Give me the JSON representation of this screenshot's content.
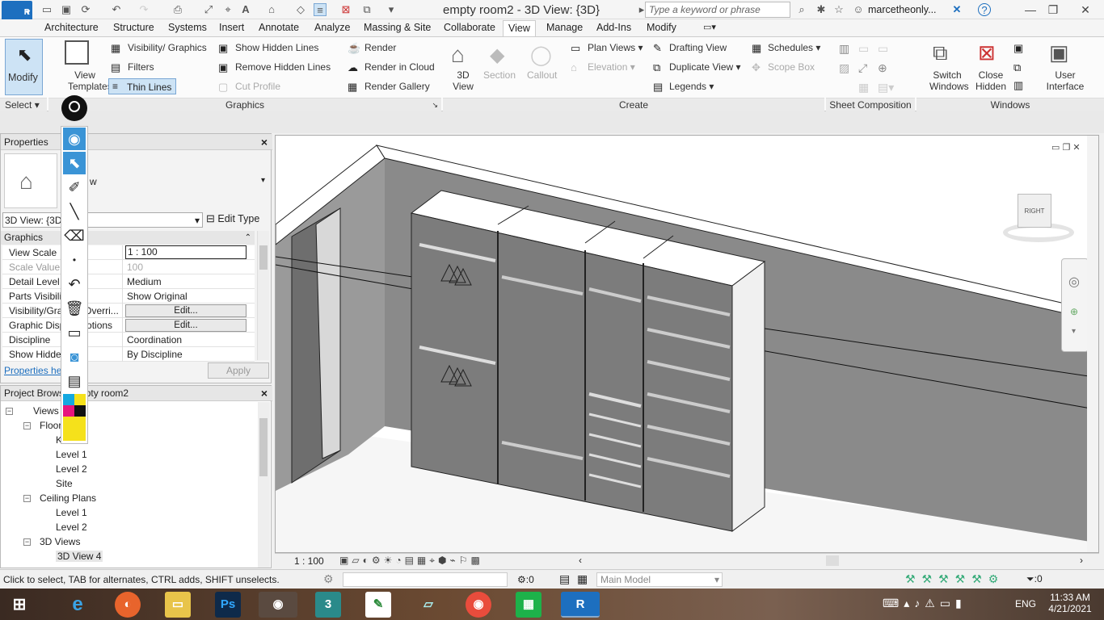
{
  "app": {
    "logo": "R",
    "title": "empty room2 - 3D View: {3D}",
    "search_placeholder": "Type a keyword or phrase",
    "user": "marcetheonly...",
    "accent": "#1d6fbf"
  },
  "tabs": [
    "Architecture",
    "Structure",
    "Systems",
    "Insert",
    "Annotate",
    "Analyze",
    "Massing & Site",
    "Collaborate",
    "View",
    "Manage",
    "Add-Ins",
    "Modify"
  ],
  "active_tab": "View",
  "ribbon": {
    "modify_label": "Modify",
    "select_label": "Select",
    "view_templates": "View Templates",
    "visibility_graphics": "Visibility/ Graphics",
    "filters": "Filters",
    "thin_lines": "Thin Lines",
    "show_hidden": "Show Hidden Lines",
    "remove_hidden": "Remove Hidden Lines",
    "cut_profile": "Cut Profile",
    "render": "Render",
    "render_cloud": "Render in Cloud",
    "render_gallery": "Render Gallery",
    "graphics_panel": "Graphics",
    "view_3d": "3D View",
    "section": "Section",
    "callout": "Callout",
    "plan_views": "Plan Views",
    "elevation": "Elevation",
    "drafting_view": "Drafting View",
    "duplicate_view": "Duplicate View",
    "legends": "Legends",
    "schedules": "Schedules",
    "scope_box": "Scope Box",
    "create_panel": "Create",
    "sheet_panel": "Sheet Composition",
    "switch_windows": "Switch Windows",
    "close_hidden": "Close Hidden",
    "user_interface": "User Interface",
    "windows_panel": "Windows"
  },
  "properties": {
    "title": "Properties",
    "type_suffix": "w",
    "type_selector": "3D View: {3D",
    "edit_type": "Edit Type",
    "section": "Graphics",
    "rows": [
      {
        "k": "View Scale",
        "v": "1 : 100",
        "kind": "input"
      },
      {
        "k": "Scale Value",
        "v": "100",
        "kind": "dis"
      },
      {
        "k": "Detail Level",
        "v": "Medium",
        "kind": "text"
      },
      {
        "k": "Parts Visibilit",
        "v": "Show Original",
        "kind": "text"
      },
      {
        "k": "Visibility/Gra        Overri...",
        "v": "Edit...",
        "kind": "btn"
      },
      {
        "k": "Graphic Disp        otions",
        "v": "Edit...",
        "kind": "btn"
      },
      {
        "k": "Discipline",
        "v": "Coordination",
        "kind": "text"
      },
      {
        "k": "Show Hidde       s",
        "v": "By Discipline",
        "kind": "text"
      }
    ],
    "help": "Properties he",
    "apply": "Apply"
  },
  "browser": {
    "title": "Project Brows        pty room2",
    "nodes": [
      {
        "label": "Views",
        "level": 0,
        "tog": "−"
      },
      {
        "label": "Floor",
        "level": 1,
        "tog": "−"
      },
      {
        "label": "K",
        "level": 2
      },
      {
        "label": "Level 1",
        "level": 2
      },
      {
        "label": "Level 2",
        "level": 2
      },
      {
        "label": "Site",
        "level": 2
      },
      {
        "label": "Ceiling Plans",
        "level": 1,
        "tog": "−"
      },
      {
        "label": "Level 1",
        "level": 2
      },
      {
        "label": "Level 2",
        "level": 2
      },
      {
        "label": "3D Views",
        "level": 1,
        "tog": "−"
      },
      {
        "label": "3D View 4",
        "level": 2,
        "selected": true
      }
    ]
  },
  "viewcube_label": "RIGHT",
  "view_scale": "1 : 100",
  "status": {
    "hint": "Click to select, TAB for alternates, CTRL adds, SHIFT unselects.",
    "count": ":0",
    "model": "Main Model",
    "filter_count": ":0"
  },
  "taskbar": {
    "lang": "ENG",
    "time": "11:33 AM",
    "date": "4/21/2021"
  }
}
